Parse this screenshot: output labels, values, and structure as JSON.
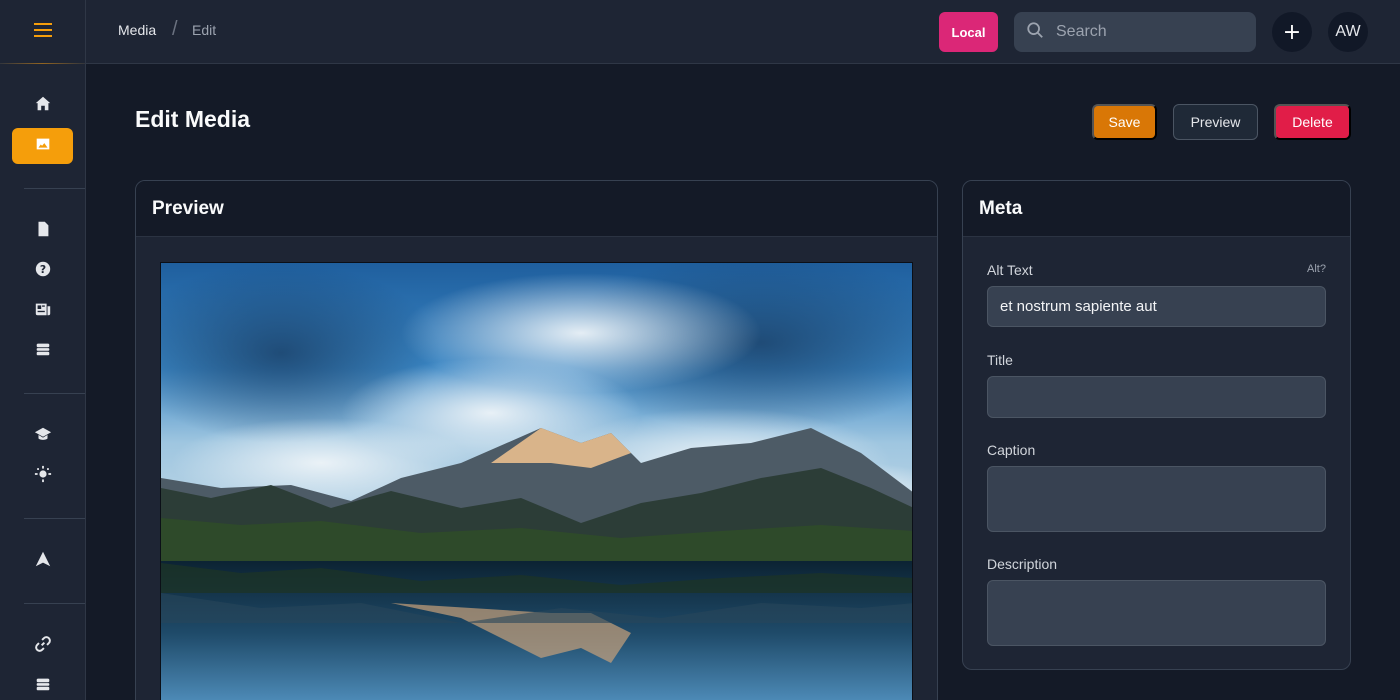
{
  "breadcrumb": {
    "parent": "Media",
    "separator": "/",
    "current": "Edit"
  },
  "topbar": {
    "env_label": "Local",
    "search_placeholder": "Search",
    "add_label": "+",
    "avatar_initials": "AW"
  },
  "page": {
    "title": "Edit Media"
  },
  "actions": {
    "save": "Save",
    "preview": "Preview",
    "delete": "Delete"
  },
  "preview_panel": {
    "title": "Preview"
  },
  "meta_panel": {
    "title": "Meta",
    "alt_text_label": "Alt Text",
    "alt_hint": "Alt?",
    "alt_text_value": "et nostrum sapiente aut",
    "title_label": "Title",
    "title_value": "",
    "caption_label": "Caption",
    "caption_value": "",
    "description_label": "Description",
    "description_value": ""
  },
  "sidebar_icons": [
    "menu-icon",
    "home-icon",
    "image-icon",
    "document-icon",
    "help-icon",
    "newspaper-icon",
    "stack-icon",
    "academic-cap-icon",
    "lightbulb-icon",
    "navigation-icon",
    "link-icon",
    "stack-icon"
  ],
  "colors": {
    "accent": "#f59e0b",
    "env_badge": "#db2777",
    "danger": "#e11d48",
    "save": "#d97706"
  }
}
